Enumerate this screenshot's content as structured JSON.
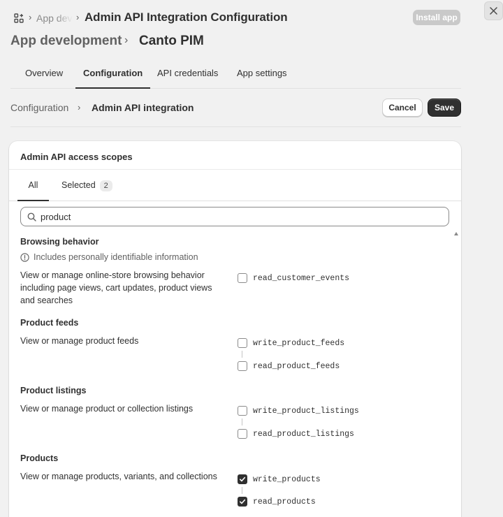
{
  "topbar": {
    "breadcrumb_faded": "App dev",
    "title": "Admin API Integration Configuration",
    "install_label": "Install app"
  },
  "header": {
    "parent": "App development",
    "current": "Canto PIM"
  },
  "tabs": [
    {
      "label": "Overview"
    },
    {
      "label": "Configuration"
    },
    {
      "label": "API credentials"
    },
    {
      "label": "App settings"
    }
  ],
  "subheader": {
    "parent": "Configuration",
    "current": "Admin API integration",
    "cancel_label": "Cancel",
    "save_label": "Save"
  },
  "card": {
    "title": "Admin API access scopes",
    "tab_all": "All",
    "tab_selected": "Selected",
    "selected_count": "2",
    "search_value": "product"
  },
  "sections": [
    {
      "title": "Browsing behavior",
      "note": "Includes personally identifiable information",
      "description": "View or manage online-store browsing behavior including page views, cart updates, product views and searches",
      "scopes": [
        {
          "name": "read_customer_events",
          "checked": false
        }
      ]
    },
    {
      "title": "Product feeds",
      "description": "View or manage product feeds",
      "scopes": [
        {
          "name": "write_product_feeds",
          "checked": false
        },
        {
          "name": "read_product_feeds",
          "checked": false
        }
      ]
    },
    {
      "title": "Product listings",
      "description": "View or manage product or collection listings",
      "scopes": [
        {
          "name": "write_product_listings",
          "checked": false
        },
        {
          "name": "read_product_listings",
          "checked": false
        }
      ]
    },
    {
      "title": "Products",
      "description": "View or manage products, variants, and collections",
      "scopes": [
        {
          "name": "write_products",
          "checked": true
        },
        {
          "name": "read_products",
          "checked": true
        }
      ]
    }
  ],
  "colors": {
    "accent": "#303030",
    "page_bg": "#f1f1f1",
    "card_bg": "#ffffff"
  }
}
